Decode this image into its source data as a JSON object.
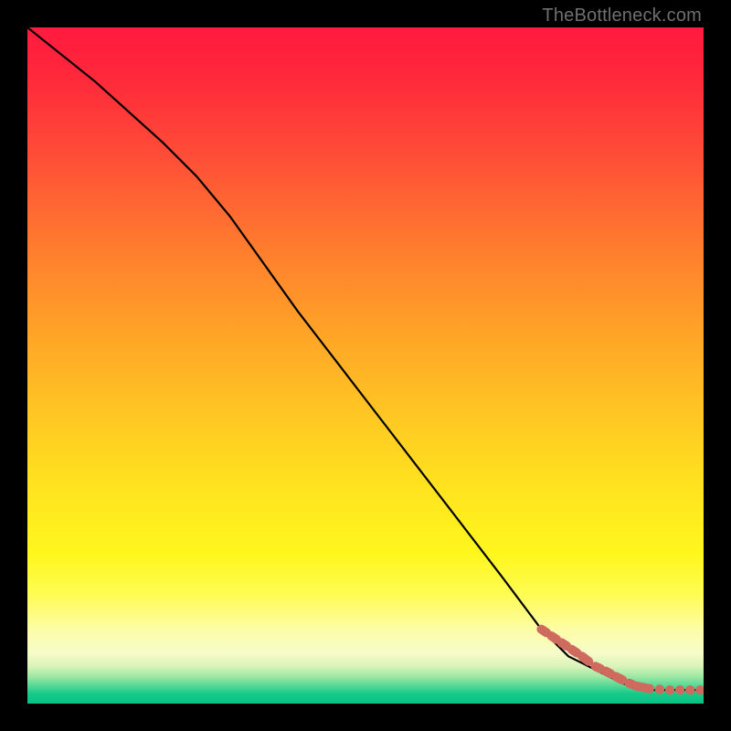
{
  "watermark": "TheBottleneck.com",
  "colors": {
    "background": "#000000",
    "curve": "#000000",
    "marker": "#cf6a5f"
  },
  "chart_data": {
    "type": "line",
    "title": "",
    "xlabel": "",
    "ylabel": "",
    "xlim": [
      0,
      100
    ],
    "ylim": [
      0,
      100
    ],
    "series": [
      {
        "name": "bottleneck-curve",
        "x": [
          0,
          10,
          20,
          25,
          30,
          40,
          50,
          60,
          70,
          76,
          80,
          84,
          88,
          92,
          96,
          100
        ],
        "y": [
          100,
          92,
          83,
          78,
          72,
          58,
          45,
          32,
          19,
          11,
          7,
          5,
          3,
          2,
          2,
          2
        ]
      }
    ],
    "markers": {
      "name": "highlight-points",
      "x": [
        76,
        77.5,
        79,
        80.5,
        82,
        84,
        85.5,
        87,
        89,
        90,
        91,
        92,
        93.5,
        95,
        96.5,
        98,
        99.5
      ],
      "y": [
        11,
        10,
        9,
        8,
        7,
        5.5,
        4.8,
        4,
        3,
        2.6,
        2.4,
        2.2,
        2.1,
        2,
        2,
        2,
        2
      ]
    },
    "legend": false,
    "grid": false
  }
}
